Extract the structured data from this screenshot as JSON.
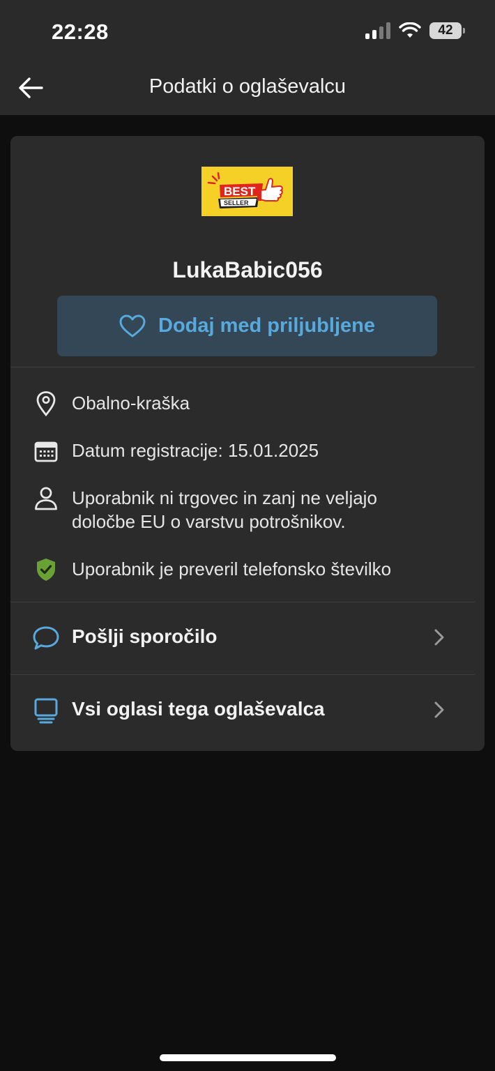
{
  "status_bar": {
    "time": "22:28",
    "battery": "42",
    "icons": [
      "cellular-signal-icon",
      "wifi-icon",
      "battery-icon"
    ]
  },
  "header": {
    "title": "Podatki o oglaševalcu",
    "back_icon": "arrow-left-icon"
  },
  "profile": {
    "badge_top": "BEST",
    "badge_bottom": "SELLER",
    "name": "LukaBabic056",
    "favorite_label": "Dodaj med priljubljene",
    "favorite_icon": "heart-outline-icon"
  },
  "info": [
    {
      "icon": "location-pin-icon",
      "text": "Obalno-kraška"
    },
    {
      "icon": "calendar-icon",
      "text": "Datum registracije: 15.01.2025"
    },
    {
      "icon": "person-icon",
      "line1": "Uporabnik ni trgovec in zanj ne veljajo",
      "line2": "določbe EU o varstvu potrošnikov."
    },
    {
      "icon": "shield-check-icon",
      "text": "Uporabnik je preveril telefonsko številko"
    }
  ],
  "links": [
    {
      "icon": "chat-bubble-icon",
      "label": "Pošlji sporočilo"
    },
    {
      "icon": "monitor-icon",
      "label": "Vsi oglasi tega oglaševalca"
    }
  ],
  "colors": {
    "accent": "#58a9dd",
    "button_bg": "#344756",
    "card_bg": "#2b2b2b",
    "verified_green": "#6aa135",
    "badge_yellow": "#f5d127",
    "badge_red": "#e0251c"
  }
}
